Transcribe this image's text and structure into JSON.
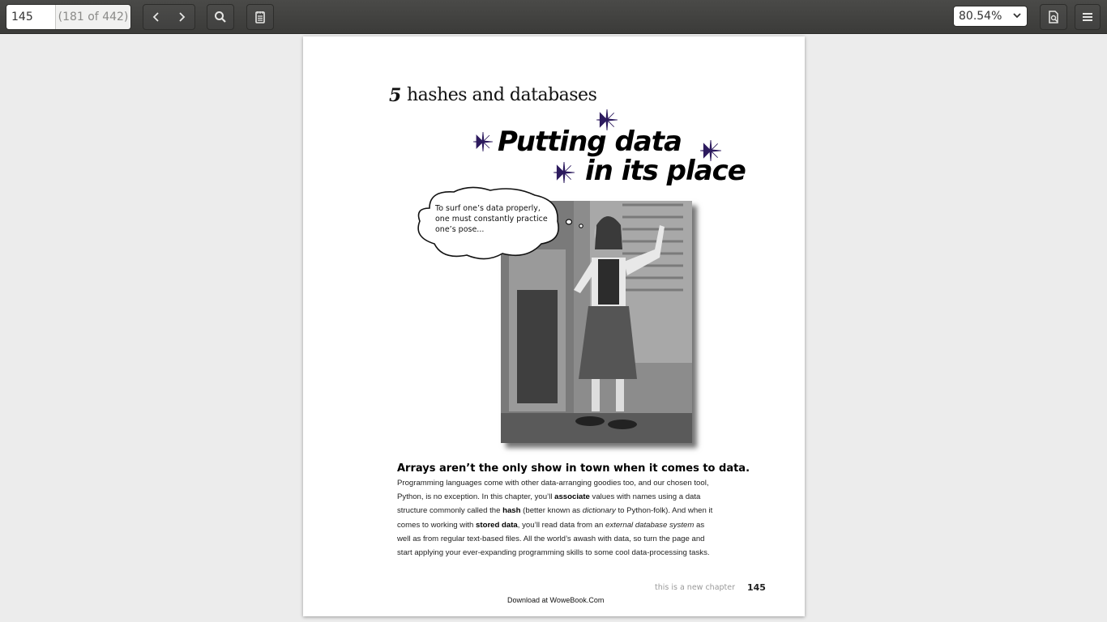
{
  "toolbar": {
    "page_input": "145",
    "page_count": "(181 of 442)",
    "zoom": "80.54%",
    "icons": [
      "chevron-left-icon",
      "chevron-right-icon",
      "search-icon",
      "notes-icon",
      "document-properties-icon",
      "menu-icon"
    ]
  },
  "page": {
    "chapter_number": "5",
    "chapter_title": "hashes and databases",
    "title_line1": "Putting data",
    "title_line2": "in its place",
    "bubble_text": "To surf one’s data properly, one must constantly practice one’s pose...",
    "heading": "Arrays aren’t the only show in town when it comes to data.",
    "body": {
      "p1": "Programming languages come with other data-arranging goodies too, and our chosen tool, Python, is no exception. In this chapter, you’ll ",
      "b1": "associate",
      "p2": " values with names using a data structure commonly called the ",
      "b2": "hash",
      "p3": " (better known as ",
      "i1": "dictionary",
      "p4": " to Python-folk). And when it comes to working with ",
      "b3": "stored data",
      "p5": ", you’ll read data from an ",
      "i2": "external database system",
      "p6": " as well as from regular text-based files. All the world’s awash with data, so turn the page and start applying your ever-expanding programming skills to some cool data-processing tasks."
    },
    "footer_note": "this is a new chapter",
    "footer_page": "145",
    "download": "Download at WoweBook.Com"
  }
}
